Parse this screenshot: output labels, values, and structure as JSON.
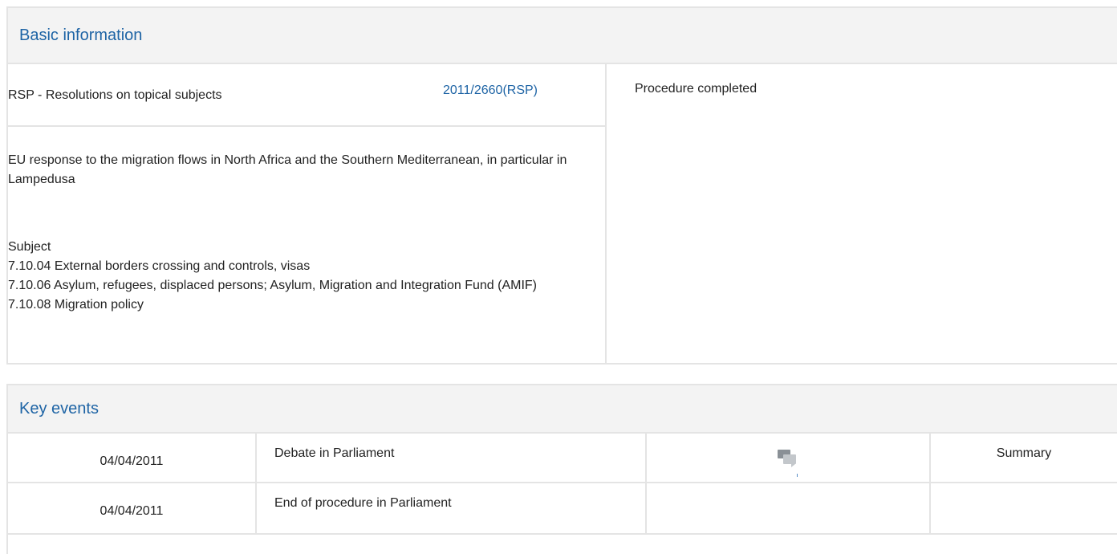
{
  "basic": {
    "header": "Basic information",
    "procedure_type": "RSP - Resolutions on topical subjects",
    "procedure_ref": "2011/2660(RSP)",
    "status": "Procedure completed",
    "title": "EU response to the migration flows in North Africa and the Southern Mediterranean, in particular in Lampedusa",
    "subject_label": "Subject",
    "subjects": [
      "7.10.04 External borders crossing and controls, visas",
      "7.10.06 Asylum, refugees, displaced persons; Asylum, Migration and Integration Fund (AMIF)",
      "7.10.08 Migration policy"
    ]
  },
  "events": {
    "header": "Key events",
    "rows": [
      {
        "date": "04/04/2011",
        "event": "Debate in Parliament",
        "doc_icon": "debate-icon",
        "summary": "Summary"
      },
      {
        "date": "04/04/2011",
        "event": "End of procedure in Parliament",
        "doc_icon": "",
        "summary": ""
      }
    ]
  }
}
